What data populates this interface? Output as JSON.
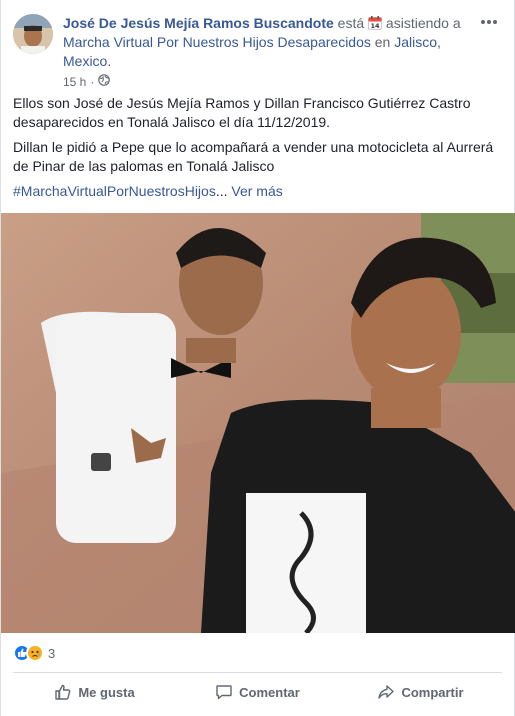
{
  "post": {
    "author": "José De Jesús Mejía Ramos Buscandote",
    "verb_before": "está",
    "verb_after": "asistiendo a",
    "event_name": "Marcha Virtual Por Nuestros Hijos Desaparecidos",
    "in_word": "en",
    "location": "Jalisco, Mexico.",
    "time": "15 h",
    "dot": "·",
    "calendar_day": "14",
    "paragraph1": "Ellos son José de Jesús Mejía Ramos y Dillan Francisco Gutiérrez Castro desaparecidos en Tonalá Jalisco el día 11/12/2019.",
    "paragraph2": "Dillan le pidió a Pepe que lo acompañará a vender una motocicleta al Aurrerá de Pinar de las palomas en Tonalá Jalisco",
    "hashtag": "#MarchaVirtualPorNuestrosHijos",
    "ellipsis": "...",
    "see_more": "Ver más"
  },
  "reactions": {
    "icons": [
      "like-icon",
      "sad-icon"
    ],
    "count": "3"
  },
  "actions": {
    "like": "Me gusta",
    "comment": "Comentar",
    "share": "Compartir"
  },
  "colors": {
    "link": "#385898",
    "muted": "#616770",
    "like_blue": "#1877f2",
    "sad_yellow": "#f7b125"
  }
}
